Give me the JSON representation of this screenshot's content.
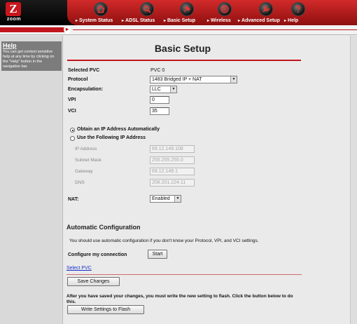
{
  "brand": {
    "logo_letter": "Z",
    "logo_word": "zoom",
    "accent": "#c0161c",
    "nav_gradient": [
      "#d22a2a",
      "#8e0f0f"
    ]
  },
  "nav": [
    {
      "label": "System Status",
      "icon": "home-icon"
    },
    {
      "label": "ADSL Status",
      "icon": "magnifier-icon"
    },
    {
      "label": "Basic Setup",
      "icon": "tool-icon"
    },
    {
      "label": "Wireless",
      "icon": "wireless-icon"
    },
    {
      "label": "Advanced Setup",
      "icon": "wrench-icon"
    },
    {
      "label": "Help",
      "icon": "question-icon"
    }
  ],
  "help": {
    "title": "Help",
    "text": "You can get context sensitive help at any time by clicking on the \"Help\" button in the navigation bar."
  },
  "page": {
    "title": "Basic Setup"
  },
  "form": {
    "selected_pvc_label": "Selected PVC",
    "selected_pvc_value": "PVC 0",
    "protocol_label": "Protocol",
    "protocol_value": "1483 Bridged IP + NAT",
    "encapsulation_label": "Encapsulation:",
    "encapsulation_value": "LLC",
    "vpi_label": "VPI",
    "vpi_value": "0",
    "vci_label": "VCI",
    "vci_value": "35",
    "obtain_auto_label": "Obtain an IP Address Automatically",
    "obtain_auto_selected": true,
    "use_following_label": "Use the Following IP Address",
    "ip_address_label": "IP Address",
    "ip_address_value": "69.12.149.108",
    "subnet_mask_label": "Subnet Mask",
    "subnet_mask_value": "255.255.255.0",
    "gateway_label": "Gateway",
    "gateway_value": "69.12.149.1",
    "dns_label": "DNS",
    "dns_value": "208.201.224.11",
    "nat_label": "NAT:",
    "nat_value": "Enabled"
  },
  "auto": {
    "heading": "Automatic Configuration",
    "note": "You should use automatic configuration if you don't know your Protocol, VPI, and VCI settings.",
    "configure_label": "Configure my connection",
    "start_button": "Start"
  },
  "actions": {
    "select_pvc_link": "Select PVC",
    "save_button": "Save Changes",
    "flash_note": "After you have saved your changes, you must write the new setting to flash. Click the button below to do this.",
    "flash_button": "Write Settings to Flash"
  }
}
